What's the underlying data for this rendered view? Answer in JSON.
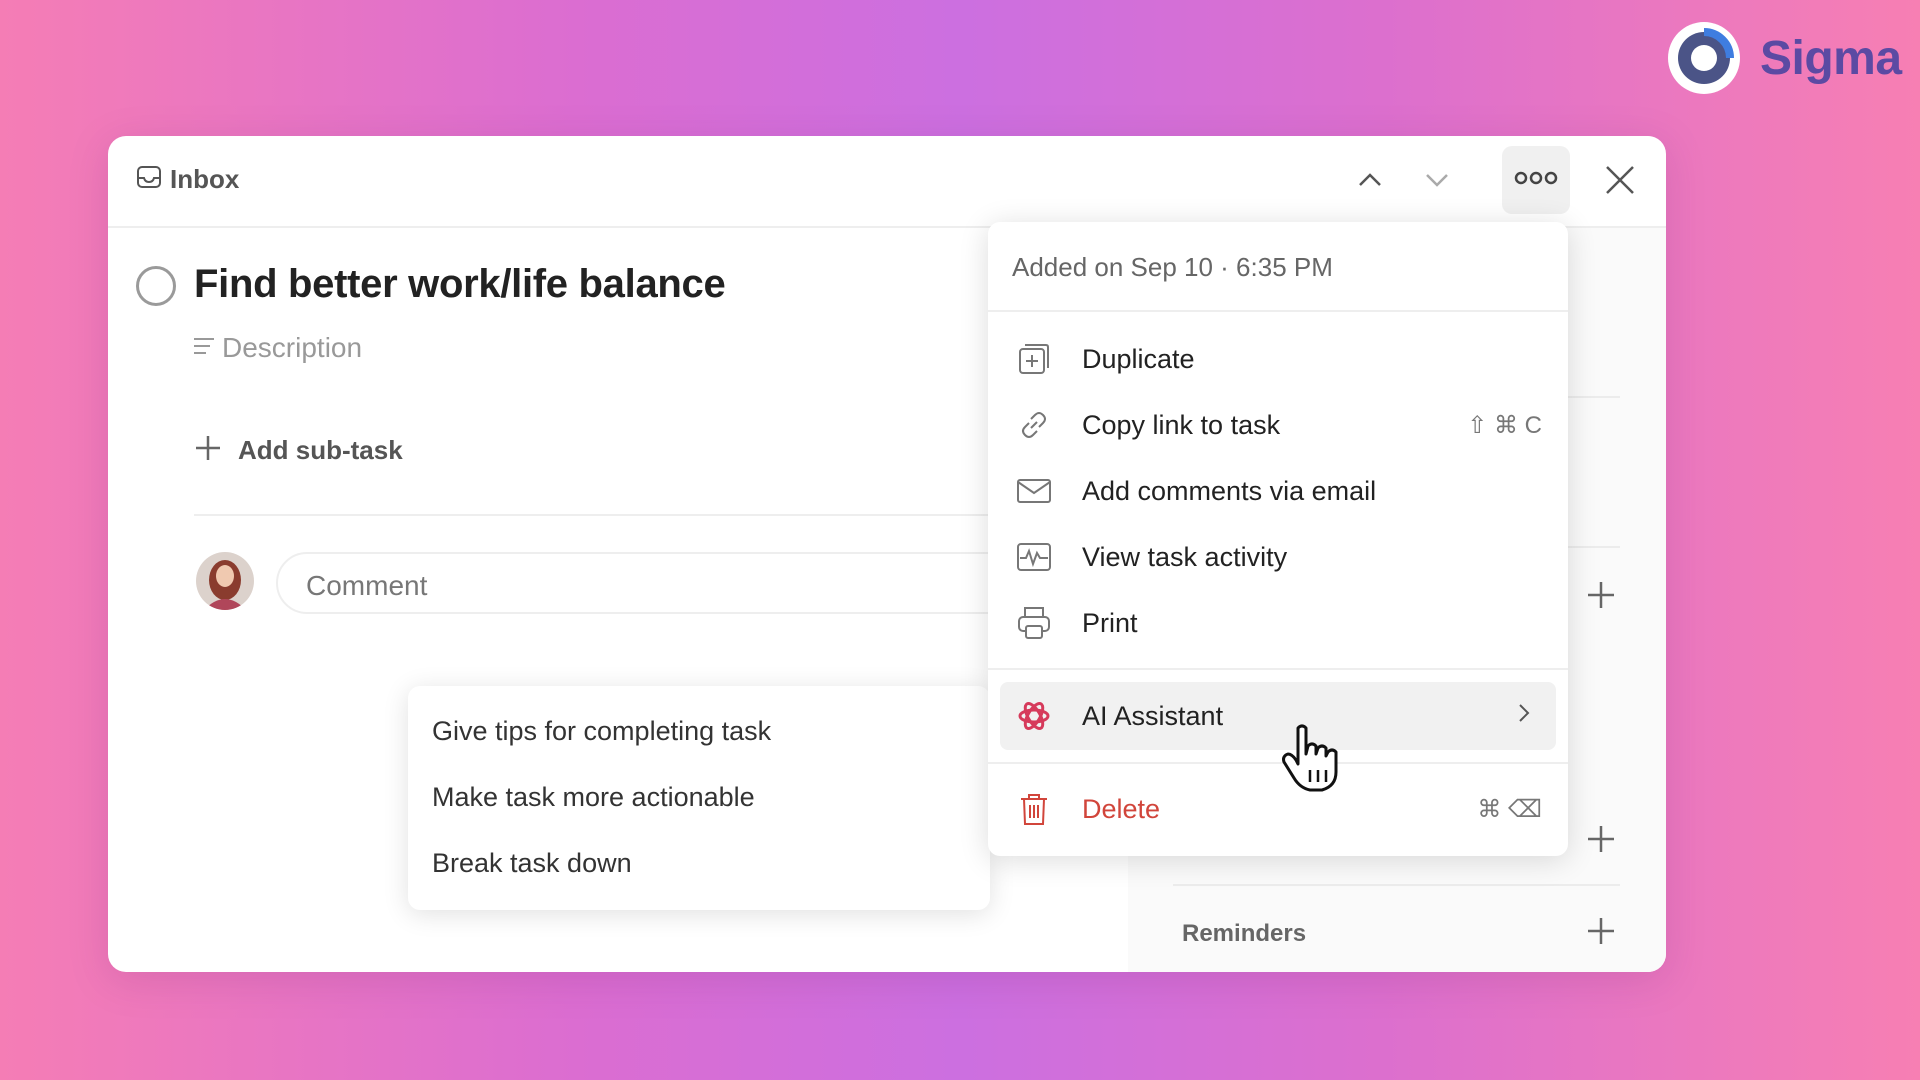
{
  "brand": {
    "name": "Sigma",
    "logo_icon": "sigma-ring-logo",
    "color": "#5b4aa3"
  },
  "header": {
    "breadcrumb": "Inbox",
    "breadcrumb_icon": "inbox-icon",
    "nav": [
      "chevron-up-icon",
      "chevron-down-icon"
    ],
    "more_icon": "more-horizontal-icon",
    "close_icon": "close-icon"
  },
  "task": {
    "title": "Find better work/life balance",
    "description_placeholder": "Description",
    "add_subtask_label": "Add sub-task",
    "comment_placeholder": "Comment"
  },
  "menu": {
    "meta": "Added on Sep 10 · 6:35 PM",
    "items": [
      {
        "label": "Duplicate",
        "icon": "duplicate-icon",
        "shortcut": ""
      },
      {
        "label": "Copy link to task",
        "icon": "link-icon",
        "shortcut": "⇧ ⌘ C"
      },
      {
        "label": "Add comments via email",
        "icon": "email-icon",
        "shortcut": ""
      },
      {
        "label": "View task activity",
        "icon": "activity-icon",
        "shortcut": ""
      },
      {
        "label": "Print",
        "icon": "printer-icon",
        "shortcut": ""
      }
    ],
    "ai": {
      "label": "AI Assistant",
      "icon": "ai-assistant-icon",
      "chevron": "chevron-right-icon"
    },
    "delete": {
      "label": "Delete",
      "icon": "trash-icon",
      "shortcut": "⌘ ⌫",
      "color": "#d1453b"
    }
  },
  "ai_submenu": {
    "items": [
      "Give tips for completing task",
      "Make task more actionable",
      "Break task down"
    ]
  },
  "right_panel": {
    "reminders_label": "Reminders"
  },
  "colors": {
    "background_left": "#f57db5",
    "background_center": "#cc6fe0",
    "danger": "#d1453b"
  }
}
